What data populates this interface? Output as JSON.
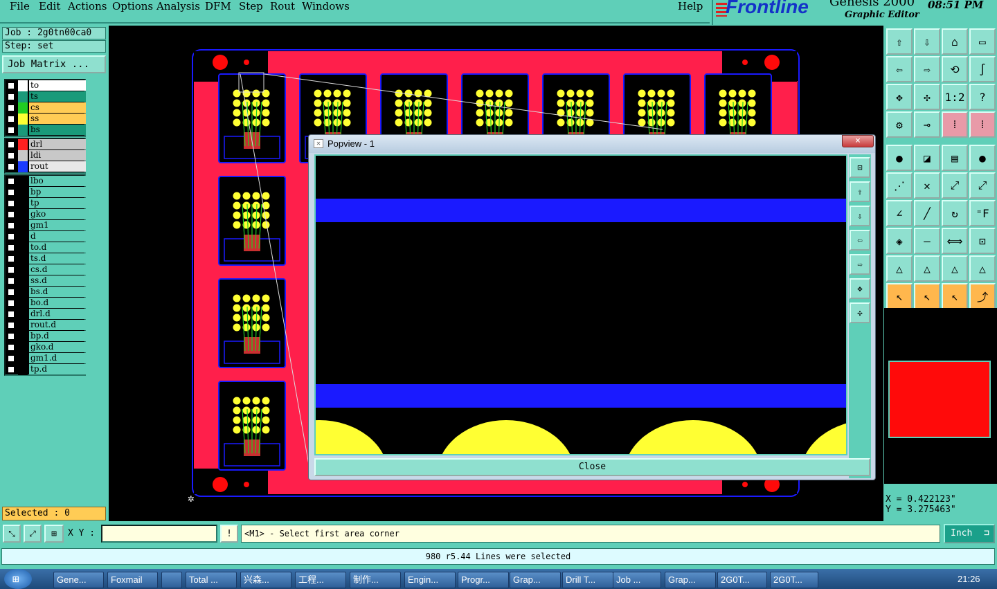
{
  "menu": {
    "items": [
      "File",
      "Edit",
      "Actions",
      "Options",
      "Analysis",
      "DFM",
      "Step",
      "Rout",
      "Windows"
    ],
    "help": "Help"
  },
  "logo": {
    "brand": "Frontline",
    "product": "Genesis 2000",
    "subtitle": "Graphic Editor",
    "time": "08:51 PM"
  },
  "job": {
    "job_label": "Job : 2g0tn00ca0",
    "step_label": "Step: set",
    "matrix_button": "Job Matrix ..."
  },
  "layers": {
    "group1": [
      {
        "name": "to",
        "color": "#ffffff",
        "bg": "#ffffff"
      },
      {
        "name": "ts",
        "color": "#1a9a7a",
        "bg": "#1a9a7a"
      },
      {
        "name": "cs",
        "color": "#22cc22",
        "bg": "#ffcc55"
      },
      {
        "name": "ss",
        "color": "#ffff33",
        "bg": "#ffcc55"
      },
      {
        "name": "bs",
        "color": "#1a9a7a",
        "bg": "#1a9a7a"
      }
    ],
    "group2": [
      {
        "name": "drl",
        "color": "#ff2020",
        "bg": "#c8c8c8"
      },
      {
        "name": "ldi",
        "color": "#c8c8c8",
        "bg": "#c8c8c8"
      },
      {
        "name": "rout",
        "color": "#1a3aff",
        "bg": "#e8e8e8"
      }
    ],
    "group3": [
      "lbo",
      "bp",
      "tp",
      "gko",
      "gm1",
      "d",
      "to.d",
      "ts.d",
      "cs.d",
      "ss.d",
      "bs.d",
      "bo.d",
      "drl.d",
      "rout.d",
      "bp.d",
      "gko.d",
      "gm1.d",
      "tp.d"
    ]
  },
  "selected": "Selected : 0",
  "coords": {
    "x": "X = 0.422123\"",
    "y": "Y = 3.275463\""
  },
  "command": {
    "xy_label": "X Y :",
    "xy_value": "",
    "prompt": "<M1> - Select first area corner",
    "units": "Inch"
  },
  "status": "980 r5.44 Lines were selected",
  "popup": {
    "title": "Popview - 1",
    "close": "Close",
    "x": "×"
  },
  "taskbar": {
    "items": [
      "Gene...",
      "Foxmail",
      "",
      "Total ...",
      "兴森...",
      "工程...",
      "制作...",
      "Engin...",
      "Progr...",
      "Grap...",
      "Drill T...",
      "Job ...",
      "Grap...",
      "2G0T...",
      "2G0T..."
    ],
    "time": "21:26"
  },
  "colors": {
    "board": "#ff1f4b",
    "pad": "#ffff33",
    "outline": "#1a1aff",
    "panel": "#5fcfb8"
  }
}
